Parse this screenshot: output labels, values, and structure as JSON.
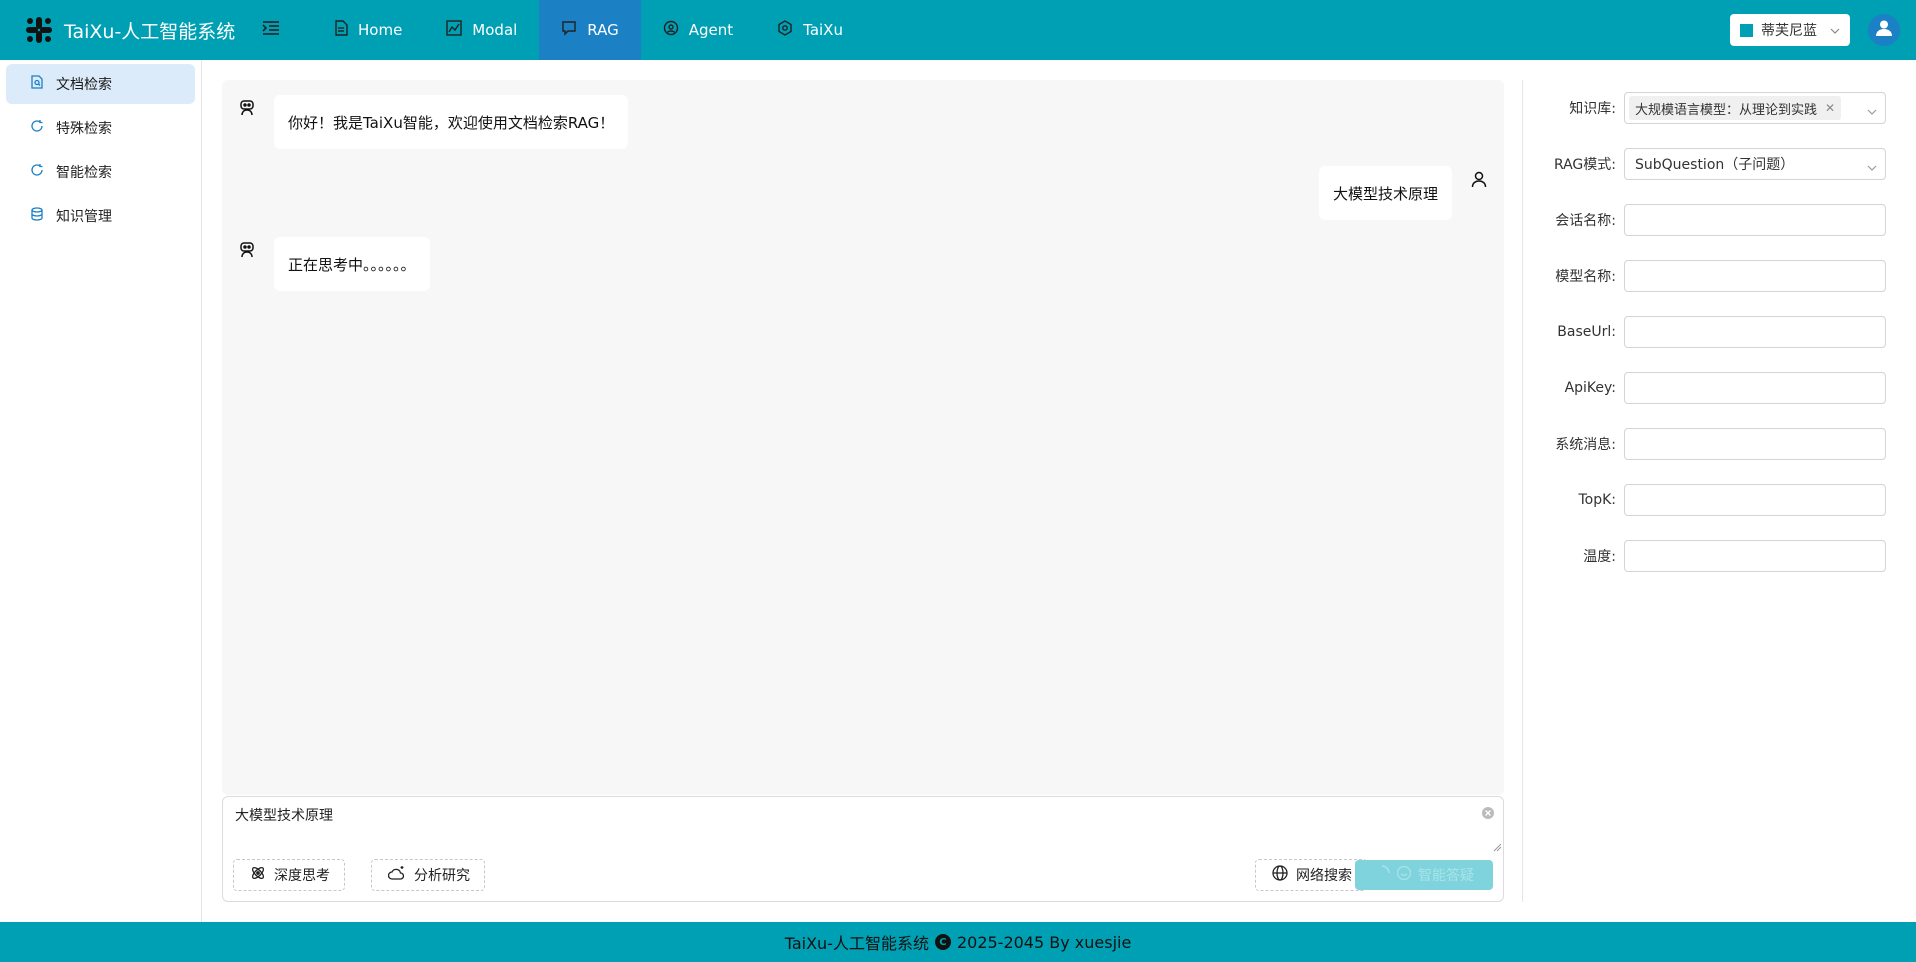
{
  "app": {
    "title": "TaiXu-人工智能系统"
  },
  "header": {
    "nav": [
      {
        "label": "Home",
        "icon": "document-icon"
      },
      {
        "label": "Modal",
        "icon": "chart-icon"
      },
      {
        "label": "RAG",
        "icon": "chat-icon",
        "active": true
      },
      {
        "label": "Agent",
        "icon": "agent-icon"
      },
      {
        "label": "TaiXu",
        "icon": "hexagon-icon"
      }
    ],
    "theme": {
      "label": "蒂芙尼蓝",
      "color": "#00a0b4"
    }
  },
  "sidebar": {
    "items": [
      {
        "label": "文档检索",
        "active": true
      },
      {
        "label": "特殊检索"
      },
      {
        "label": "智能检索"
      },
      {
        "label": "知识管理"
      }
    ]
  },
  "chat": {
    "messages": [
      {
        "role": "bot",
        "text": "你好！我是TaiXu智能，欢迎使用文档检索RAG！"
      },
      {
        "role": "user",
        "text": "大模型技术原理"
      },
      {
        "role": "bot",
        "text": "正在思考中。。。。。。"
      }
    ],
    "input": {
      "value": "大模型技术原理"
    },
    "tools": {
      "deep_think": "深度思考",
      "analysis": "分析研究",
      "web_search": "网络搜索",
      "send": "智能答疑"
    }
  },
  "settings": {
    "knowledge_base": {
      "label": "知识库:",
      "value": "大规模语言模型：从理论到实践"
    },
    "rag_mode": {
      "label": "RAG模式:",
      "value": "SubQuestion（子问题）"
    },
    "session_name": {
      "label": "会话名称:",
      "value": ""
    },
    "model_name": {
      "label": "模型名称:",
      "value": ""
    },
    "base_url": {
      "label": "BaseUrl:",
      "value": ""
    },
    "api_key": {
      "label": "ApiKey:",
      "value": ""
    },
    "system_message": {
      "label": "系统消息:",
      "value": ""
    },
    "top_k": {
      "label": "TopK:",
      "value": ""
    },
    "temperature": {
      "label": "温度:",
      "value": ""
    }
  },
  "footer": {
    "left": "TaiXu-人工智能系统",
    "mark": "C",
    "right": "2025-2045 By xuesjie"
  },
  "colors": {
    "primary": "#00a0b4",
    "active_nav": "#1c80c4",
    "sidebar_active": "#dcebfa",
    "chat_bg": "#f7f7f7"
  }
}
